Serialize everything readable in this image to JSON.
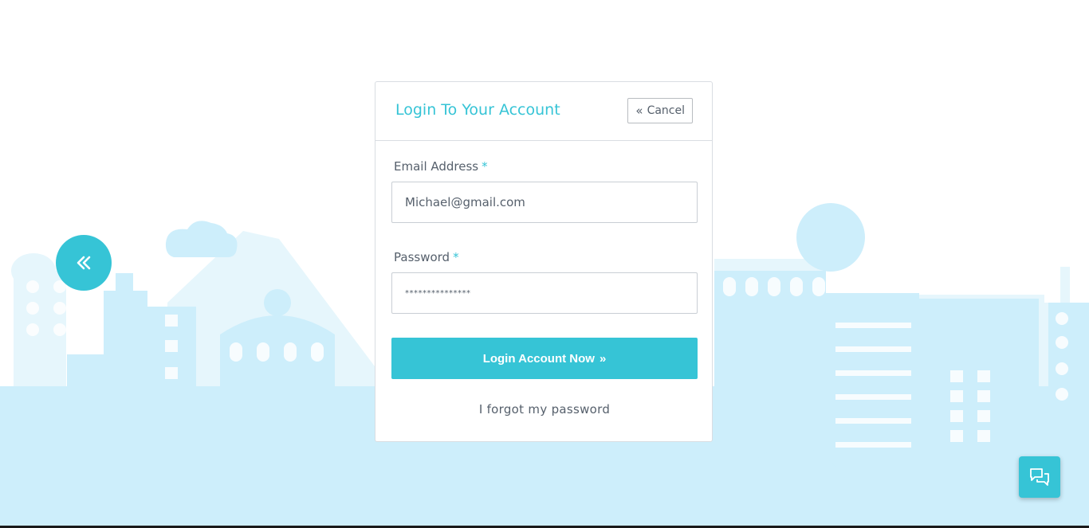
{
  "login_card": {
    "title": "Login To Your Account",
    "cancel_label": "Cancel",
    "email": {
      "label": "Email Address",
      "required_mark": "*",
      "value": "Michael@gmail.com"
    },
    "password": {
      "label": "Password",
      "required_mark": "*",
      "masked_value": "***************"
    },
    "submit_label": "Login Account Now",
    "forgot_label": "I forgot my password"
  },
  "icons": {
    "back": "double-chevron-left-icon",
    "cancel": "double-chevron-left-icon",
    "submit": "double-chevron-right-icon",
    "chat": "chat-bubbles-icon"
  },
  "colors": {
    "accent": "#36c4d6",
    "background_city_light": "#e6f6fc",
    "background_city": "#cdeefb",
    "text": "#56606c",
    "border": "#d9dde2"
  }
}
